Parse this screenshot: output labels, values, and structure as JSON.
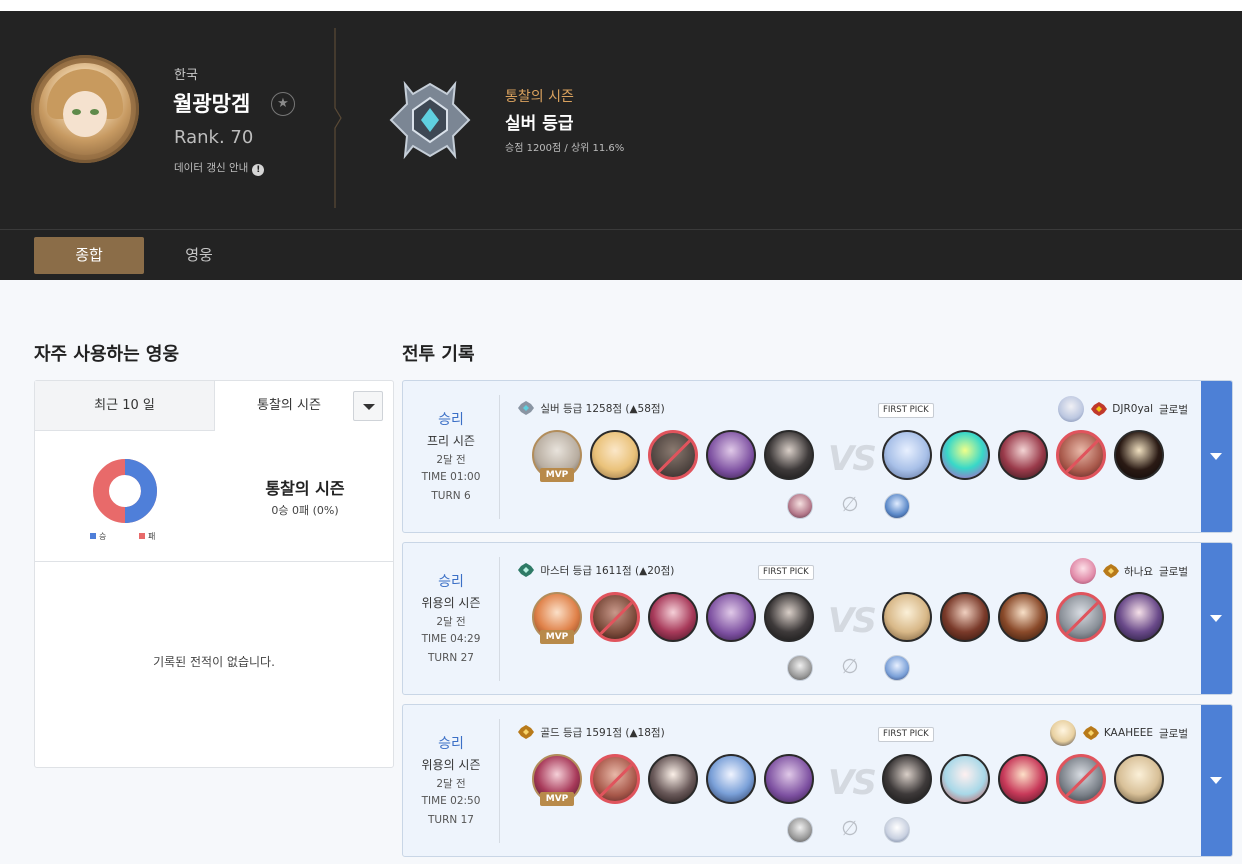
{
  "profile": {
    "region": "한국",
    "name": "월광망겜",
    "rank": "Rank. 70",
    "data_info": "데이터 갱신 안내",
    "season_label": "통찰의 시즌",
    "tier": "실버 등급",
    "tier_stats": "승점 1200점 / 상위 11.6%"
  },
  "nav": {
    "overview": "종합",
    "heroes": "영웅"
  },
  "heroes_panel": {
    "title": "자주 사용하는 영웅",
    "tab_recent": "최근 10 일",
    "tab_season": "통찰의 시즌",
    "season_name": "통찰의 시즌",
    "record": "0승 0패 (0%)",
    "legend_win": "승",
    "legend_loss": "패",
    "empty": "기록된 전적이 없습니다.",
    "win_color": "#4f7fd9",
    "loss_color": "#e86a6a"
  },
  "battle_title": "전투 기록",
  "first_pick_label": "FIRST PICK",
  "mvp_label": "MVP",
  "vs_label": "VS",
  "no_pet_icon": "∅",
  "battles": [
    {
      "result": "승리",
      "mode": "프리 시즌",
      "ago": "2달 전",
      "time": "TIME 01:00",
      "turn": "TURN 6",
      "my_tier": "실버 등급 1258점 (▲58점)",
      "opp_name": "DJR0yal",
      "opp_region": "글로벌",
      "first_pick_side": "right"
    },
    {
      "result": "승리",
      "mode": "위용의 시즌",
      "ago": "2달 전",
      "time": "TIME 04:29",
      "turn": "TURN 27",
      "my_tier": "마스터 등급 1611점 (▲20점)",
      "opp_name": "하나요",
      "opp_region": "글로벌",
      "first_pick_side": "left"
    },
    {
      "result": "승리",
      "mode": "위용의 시즌",
      "ago": "2달 전",
      "time": "TIME 02:50",
      "turn": "TURN 17",
      "my_tier": "골드 등급 1591점 (▲18점)",
      "opp_name": "KAAHEEE",
      "opp_region": "글로벌",
      "first_pick_side": "right"
    }
  ]
}
